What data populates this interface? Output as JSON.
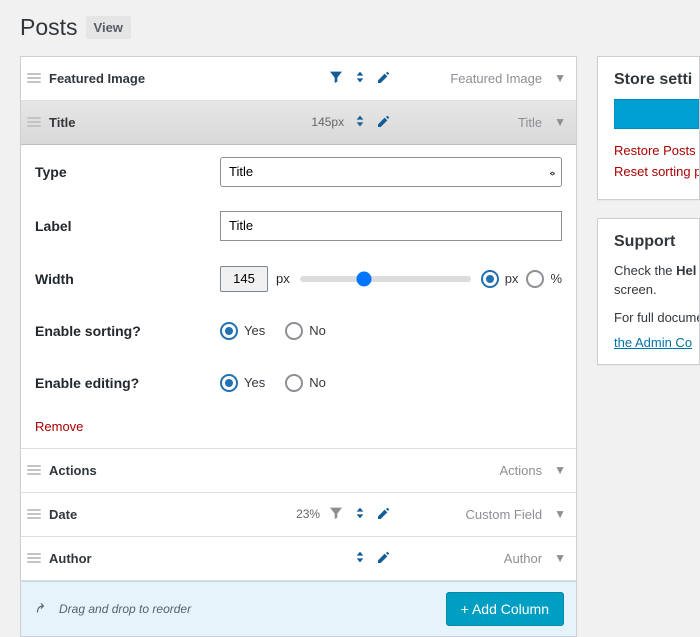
{
  "page": {
    "title": "Posts",
    "view_badge": "View"
  },
  "columns": {
    "items": [
      {
        "name": "Featured Image",
        "meta": "",
        "type_label": "Featured Image",
        "filter": true
      },
      {
        "name": "Title",
        "meta": "145px",
        "type_label": "Title",
        "filter": false,
        "selected": true
      },
      {
        "name": "Actions",
        "meta": "",
        "type_label": "Actions",
        "icons": false,
        "filter": false
      },
      {
        "name": "Date",
        "meta": "23%",
        "type_label": "Custom Field",
        "filter": true
      },
      {
        "name": "Author",
        "meta": "",
        "type_label": "Author",
        "filter": false
      }
    ]
  },
  "editor": {
    "type_label": "Type",
    "type_value": "Title",
    "label_label": "Label",
    "label_value": "Title",
    "width_label": "Width",
    "width_value": "145",
    "width_unit": "px",
    "unit_px": "px",
    "unit_pct": "%",
    "sorting_label": "Enable sorting?",
    "editing_label": "Enable editing?",
    "yes": "Yes",
    "no": "No",
    "remove": "Remove"
  },
  "footer": {
    "hint": "Drag and drop to reorder",
    "add_button": "+ Add Column"
  },
  "sidebar": {
    "store": {
      "title": "Store setti",
      "restore": "Restore Posts",
      "reset": "Reset sorting p"
    },
    "support": {
      "title": "Support",
      "p1a": "Check the ",
      "p1b": "Hel",
      "p1c": "screen.",
      "p2": "For full docume feature sugge",
      "link": "the Admin Co"
    }
  },
  "colors": {
    "accent": "#135E96",
    "danger": "#a00",
    "primary_bg": "#009ec2"
  },
  "chart_data": null
}
